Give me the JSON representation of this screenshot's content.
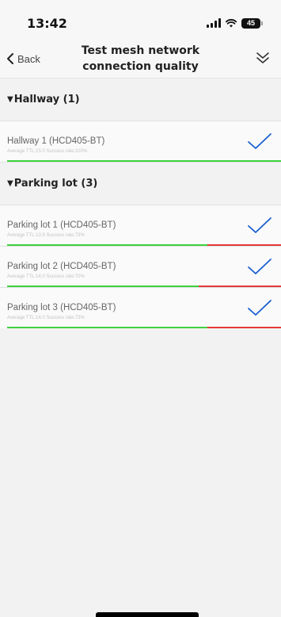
{
  "status_bar": {
    "time": "13:42",
    "battery": "45"
  },
  "nav": {
    "back_label": "Back",
    "title_line1": "Test mesh network",
    "title_line2": "connection quality"
  },
  "colors": {
    "accent": "#1a5fd0",
    "good": "#3ed13e",
    "bad": "#e53a3a"
  },
  "icons": {
    "back": "chevron-left-icon",
    "action": "double-chevron-down-icon",
    "check": "checkmark-icon"
  },
  "sections": [
    {
      "title": "Hallway (1)",
      "nodes": [
        {
          "name": "Hallway 1 (HCD405-BT)",
          "stats": "Average TTL:15.0 Success rate:100%",
          "success_rate": 1.0
        }
      ]
    },
    {
      "title": "Parking lot (3)",
      "nodes": [
        {
          "name": "Parking lot 1 (HCD405-BT)",
          "stats": "Average TTL:13.9 Success rate:73%",
          "success_rate": 0.73
        },
        {
          "name": "Parking lot 2 (HCD405-BT)",
          "stats": "Average TTL:14.0 Success rate:70%",
          "success_rate": 0.7
        },
        {
          "name": "Parking lot 3 (HCD405-BT)",
          "stats": "Average TTL:14.0 Success rate:73%",
          "success_rate": 0.73
        }
      ]
    }
  ]
}
